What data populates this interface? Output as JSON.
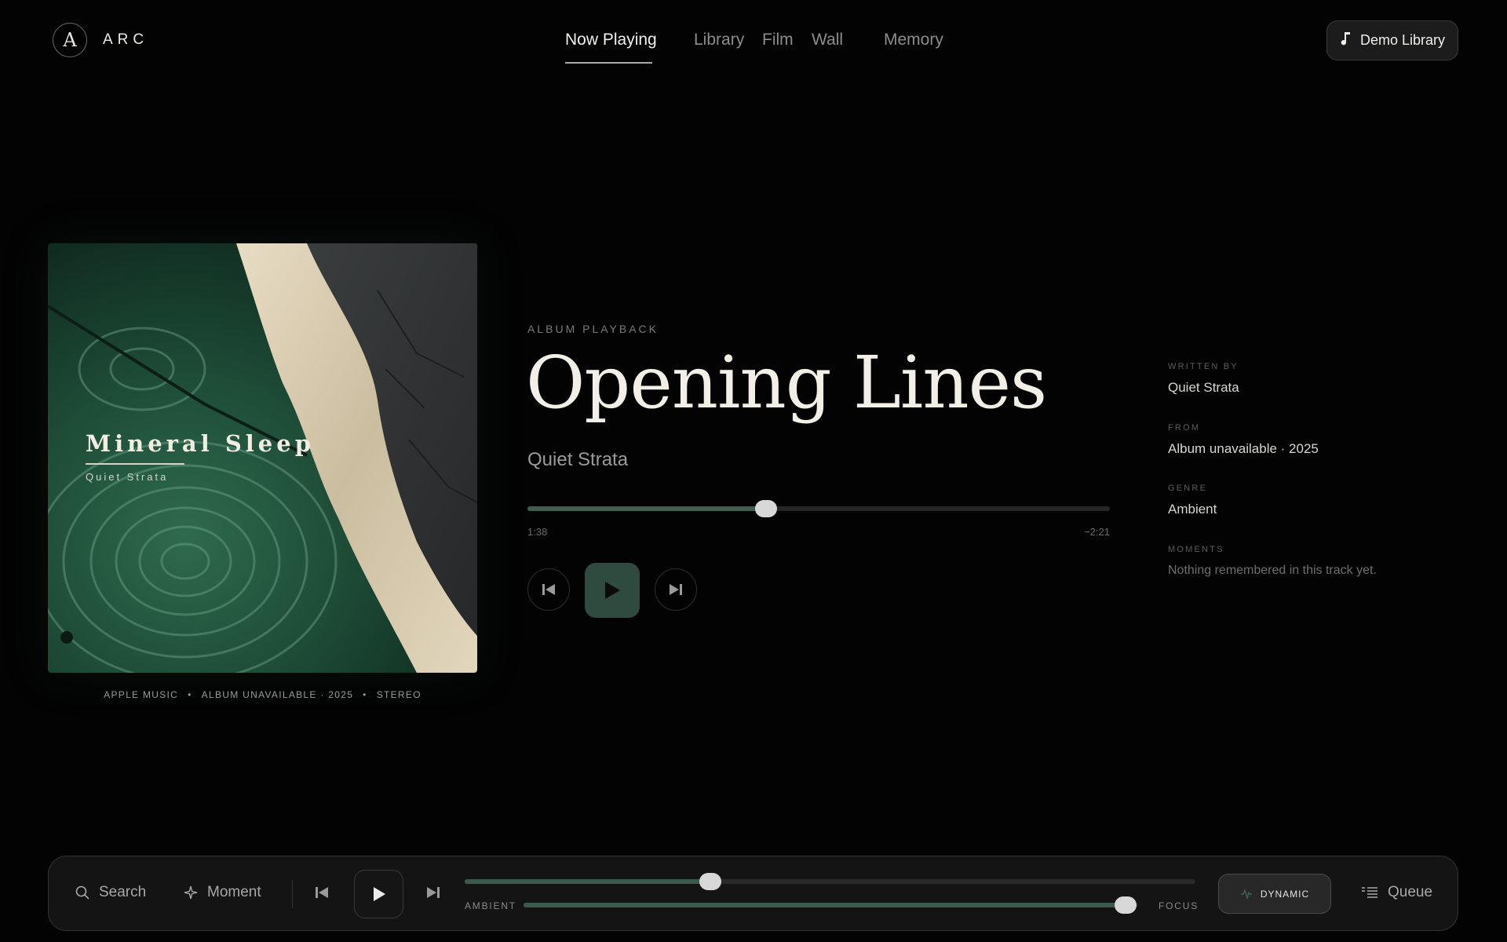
{
  "header": {
    "logo_letter": "A",
    "logo_text": "ARC",
    "nav": [
      "Now Playing",
      "Library",
      "Film",
      "Wall",
      "Memory"
    ],
    "active_nav": "Now Playing",
    "demo_button": "Demo Library"
  },
  "album": {
    "title": "Mineral Sleep",
    "artist": "Quiet Strata",
    "meta": [
      "APPLE MUSIC",
      "ALBUM UNAVAILABLE · 2025",
      "STEREO"
    ]
  },
  "player": {
    "eyebrow": "ALBUM PLAYBACK",
    "title": "Opening Lines",
    "artist": "Quiet Strata",
    "elapsed": "1:38",
    "remaining": "−2:21",
    "progress": 0.41
  },
  "info": [
    {
      "label": "WRITTEN BY",
      "value": "Quiet Strata"
    },
    {
      "label": "FROM",
      "value": "Album unavailable · 2025"
    },
    {
      "label": "GENRE",
      "value": "Ambient"
    },
    {
      "label": "MOMENTS",
      "value": "Nothing remembered in this track yet."
    }
  ],
  "bottom_bar": {
    "search": "Search",
    "moment": "Moment",
    "progress": 0.336,
    "mix_left": "AMBIENT",
    "mix_right": "FOCUS",
    "mix_value": 0.98,
    "dynamic": "DYNAMIC",
    "queue": "Queue"
  },
  "colors": {
    "accent_green": "#3f5e4f",
    "background": "#030303"
  }
}
